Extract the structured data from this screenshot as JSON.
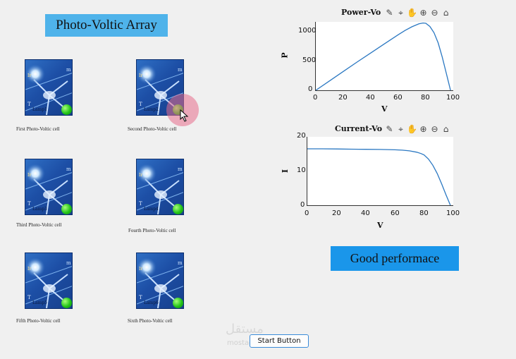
{
  "app": {
    "title": "Photo-Voltic Array"
  },
  "cells": [
    {
      "label": "First Photo-Voltic cell",
      "lamp": "Lamp1",
      "m": "m",
      "t": "T",
      "ir": "Ir"
    },
    {
      "label": "Second Photo-Voltic cell",
      "lamp": "Lamp2",
      "m": "m",
      "t": "T",
      "ir": "Ir"
    },
    {
      "label": "Third Photo-Voltic cell",
      "lamp": "Lamp3",
      "m": "m",
      "t": "T",
      "ir": "Ir"
    },
    {
      "label": "Fourth Photo-Voltic cell",
      "lamp": "Lamp4",
      "m": "m",
      "t": "T",
      "ir": "Ir"
    },
    {
      "label": "Fifth Photo-Voltic cell",
      "lamp": "Lamp5",
      "m": "m",
      "t": "T",
      "ir": "Ir"
    },
    {
      "label": "Sixth Photo-Voltic cell",
      "lamp": "Lamp6",
      "m": "m",
      "t": "T",
      "ir": "Ir"
    }
  ],
  "toolbar_icons": [
    "brush-icon",
    "data-cursor-icon",
    "pan-icon",
    "zoom-in-icon",
    "zoom-out-icon",
    "home-icon"
  ],
  "status": {
    "performance": "Good performace"
  },
  "controls": {
    "start_label": "Start Button"
  },
  "watermark": {
    "arabic": "مستقل",
    "latin": "mostaql.com"
  },
  "colors": {
    "title_bg": "#4fb3ea",
    "perf_bg": "#1a96ea",
    "curve": "#2b78c2",
    "lamp": "#22c317"
  },
  "chart_data": [
    {
      "type": "line",
      "title": "Power-Vo",
      "xlabel": "V",
      "ylabel": "P",
      "xlim": [
        0,
        100
      ],
      "ylim": [
        0,
        1200
      ],
      "xticks": [
        "0",
        "20",
        "40",
        "60",
        "80",
        "100"
      ],
      "yticks": [
        "0",
        "500",
        "1000"
      ],
      "series": [
        {
          "x": [
            0,
            10,
            20,
            30,
            40,
            50,
            60,
            65,
            70,
            75,
            78,
            80,
            83,
            86,
            89,
            92,
            95,
            98
          ],
          "values": [
            0,
            165,
            330,
            495,
            655,
            815,
            975,
            1050,
            1115,
            1165,
            1180,
            1175,
            1120,
            1010,
            830,
            580,
            290,
            0
          ]
        }
      ],
      "grid": false
    },
    {
      "type": "line",
      "title": "Current-Vo",
      "xlabel": "V",
      "ylabel": "I",
      "xlim": [
        0,
        100
      ],
      "ylim": [
        0,
        20
      ],
      "xticks": [
        "0",
        "20",
        "40",
        "60",
        "80",
        "100"
      ],
      "yticks": [
        "0",
        "10",
        "20"
      ],
      "series": [
        {
          "x": [
            0,
            10,
            20,
            30,
            40,
            50,
            60,
            65,
            70,
            75,
            78,
            80,
            83,
            86,
            89,
            92,
            95,
            98
          ],
          "values": [
            16.5,
            16.5,
            16.45,
            16.4,
            16.35,
            16.3,
            16.2,
            16.1,
            15.9,
            15.5,
            15.1,
            14.7,
            13.5,
            11.7,
            9.3,
            6.3,
            3.1,
            0
          ]
        }
      ],
      "grid": false
    }
  ]
}
